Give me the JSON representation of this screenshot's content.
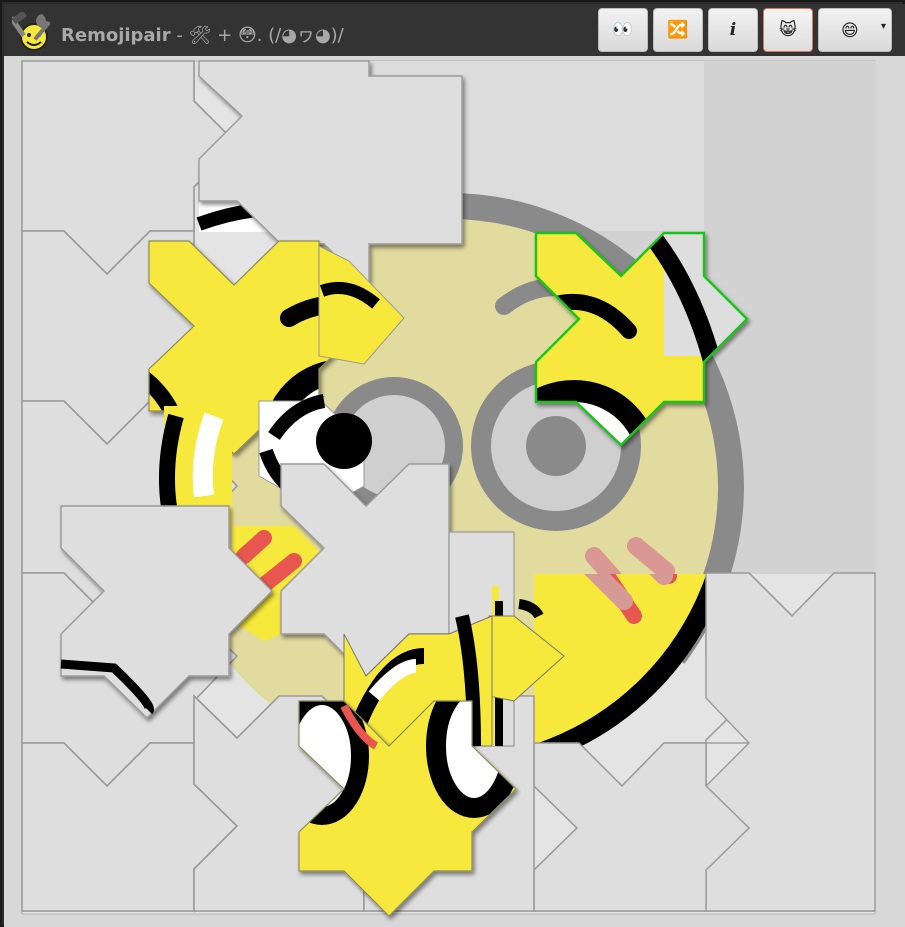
{
  "app": {
    "name": "Remojipair",
    "separator": " - ",
    "subtitle": "🛠 + 😳. (/◕ヮ◕)/"
  },
  "toolbar": {
    "buttons": [
      {
        "label": "👀",
        "name": "peek-button",
        "icon": "eyes-icon"
      },
      {
        "label": "🔀",
        "name": "shuffle-button",
        "icon": "shuffle-icon"
      },
      {
        "label": "i",
        "name": "info-button",
        "icon": "info-icon"
      },
      {
        "label": "😸",
        "name": "cat-mode-button",
        "icon": "grinning-cat-icon",
        "active": true
      }
    ],
    "emoji_select": {
      "value": "😄",
      "icon": "grinning-face-icon",
      "caret": "▾"
    }
  },
  "puzzle": {
    "target_emoji": "flushed-face",
    "colors": {
      "face": "#f7e83c",
      "outline": "#000000",
      "blush": "#e8574f",
      "empty_piece": "#dfdfdf",
      "ghost_overlay": "#d0d0d0",
      "highlight": "#17c617"
    },
    "selected_piece": "green-outlined-piece"
  }
}
